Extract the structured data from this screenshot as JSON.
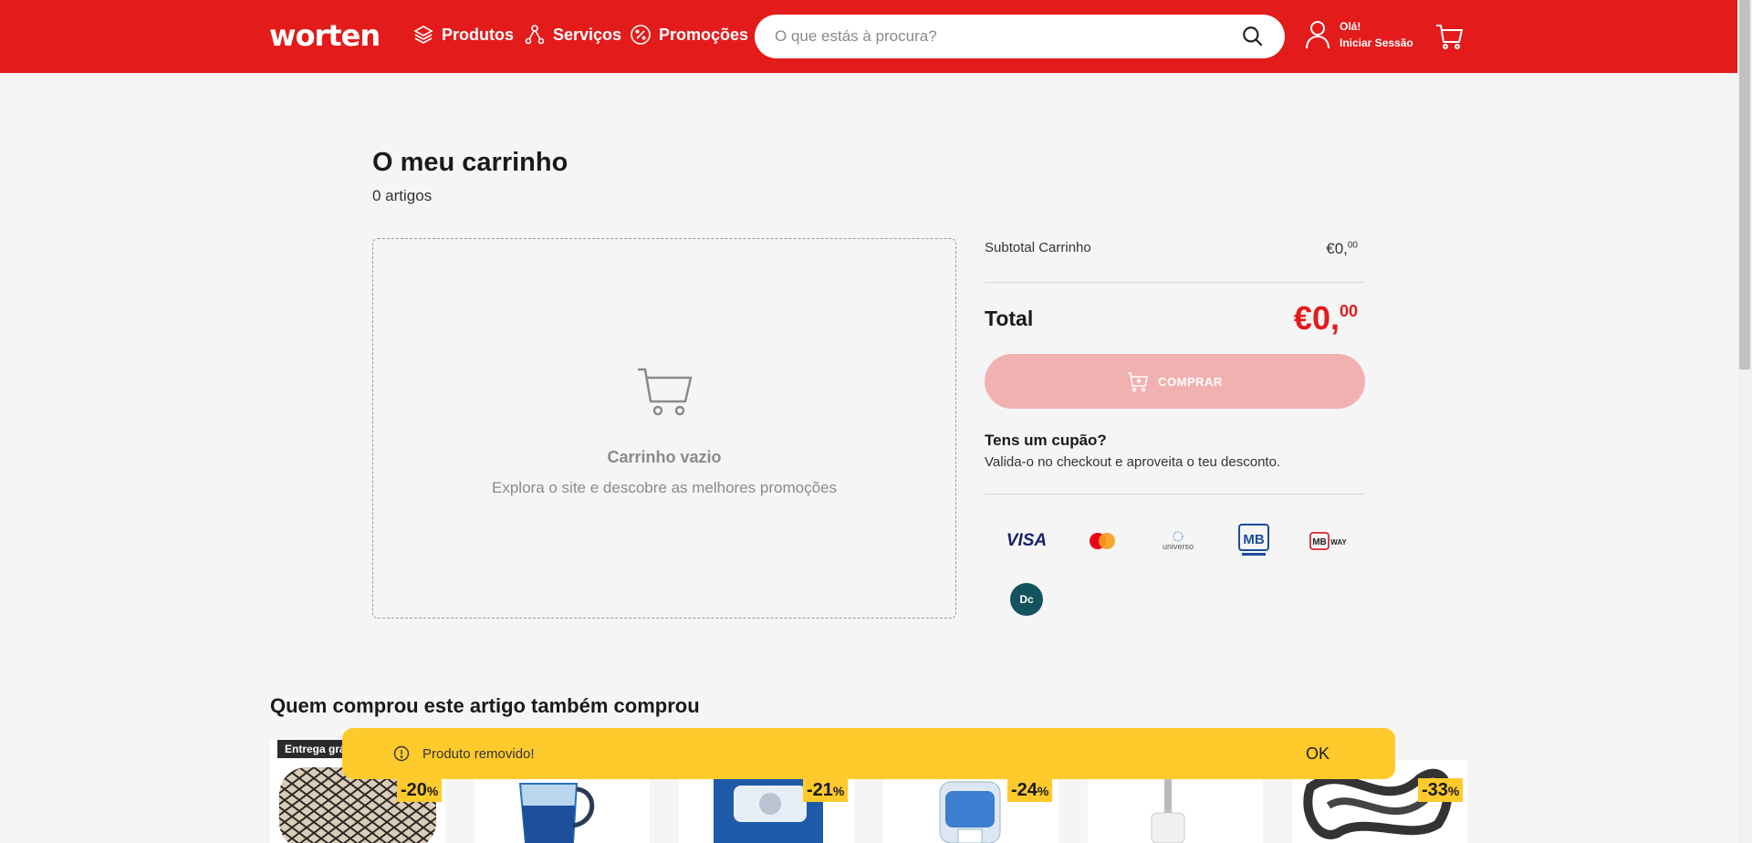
{
  "header": {
    "logo": "worten",
    "nav": [
      {
        "label": "Produtos",
        "icon": "layers-icon"
      },
      {
        "label": "Serviços",
        "icon": "network-icon"
      },
      {
        "label": "Promoções",
        "icon": "percent-badge-icon"
      }
    ],
    "search_placeholder": "O que estás à procura?",
    "account_greeting": "Olá!",
    "account_login": "Iniciar Sessão",
    "brand_color": "#e31b1b"
  },
  "cart": {
    "title": "O meu carrinho",
    "count_label": "0 artigos",
    "empty_title": "Carrinho vazio",
    "empty_subtitle": "Explora o site e descobre as melhores promoções"
  },
  "summary": {
    "subtotal_label": "Subtotal Carrinho",
    "subtotal_main": "€0,",
    "subtotal_cents": "00",
    "total_label": "Total",
    "total_main": "€0,",
    "total_cents": "00",
    "buy_label": "COMPRAR",
    "coupon_title": "Tens um cupão?",
    "coupon_sub": "Valida-o no checkout e aproveita o teu desconto.",
    "payments": [
      "VISA",
      "Mastercard",
      "universo",
      "MB Multibanco",
      "MB WAY",
      "Dc"
    ]
  },
  "recommendations": {
    "title": "Quem comprou este artigo também comprou",
    "shipping_badge": "Entrega grát",
    "products": [
      {
        "discount": "-20",
        "name": "pouf-product"
      },
      {
        "discount": "",
        "name": "water-jug-product"
      },
      {
        "discount": "-21",
        "name": "brita-filter-product"
      },
      {
        "discount": "-24",
        "name": "water-dispenser-product"
      },
      {
        "discount": "",
        "name": "oral-irrigator-product"
      },
      {
        "discount": "-33",
        "name": "rope-product"
      }
    ],
    "percent_sign": "%"
  },
  "toast": {
    "message": "Produto removido!",
    "ok_label": "OK"
  }
}
